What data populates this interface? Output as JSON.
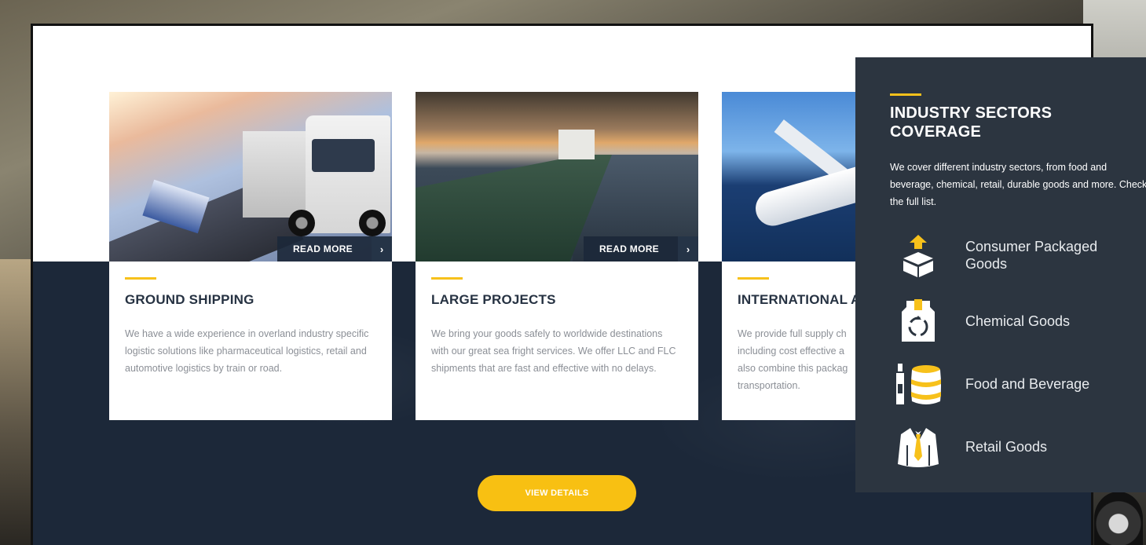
{
  "cards": [
    {
      "title": "GROUND SHIPPING",
      "text": "We have a wide experience in overland industry specific logistic solutions like pharmaceutical logistics, retail and automotive logistics by train or road.",
      "read_more": "READ MORE"
    },
    {
      "title": "LARGE PROJECTS",
      "text": "We bring your goods safely to worldwide destinations with our great sea fright services. We offer LLC and FLC shipments that are fast and effective with no delays.",
      "read_more": "READ MORE"
    },
    {
      "title": "INTERNATIONAL A",
      "text": "We provide full supply ch including cost effective a also combine this packag transportation."
    }
  ],
  "view_details": "VIEW DETAILS",
  "panel": {
    "title": "INDUSTRY SECTORS COVERAGE",
    "text": "We cover different industry sectors, from food and beverage, chemical, retail, durable goods and more. Check the full list.",
    "sectors": [
      {
        "label": "Consumer Packaged Goods",
        "icon": "box-icon"
      },
      {
        "label": "Chemical Goods",
        "icon": "recycle-icon"
      },
      {
        "label": "Food and Beverage",
        "icon": "barrel-icon"
      },
      {
        "label": "Retail Goods",
        "icon": "suit-icon"
      }
    ]
  },
  "colors": {
    "accent": "#f7c11b",
    "dark_navy": "#1c2839",
    "panel": "#2c3540"
  }
}
